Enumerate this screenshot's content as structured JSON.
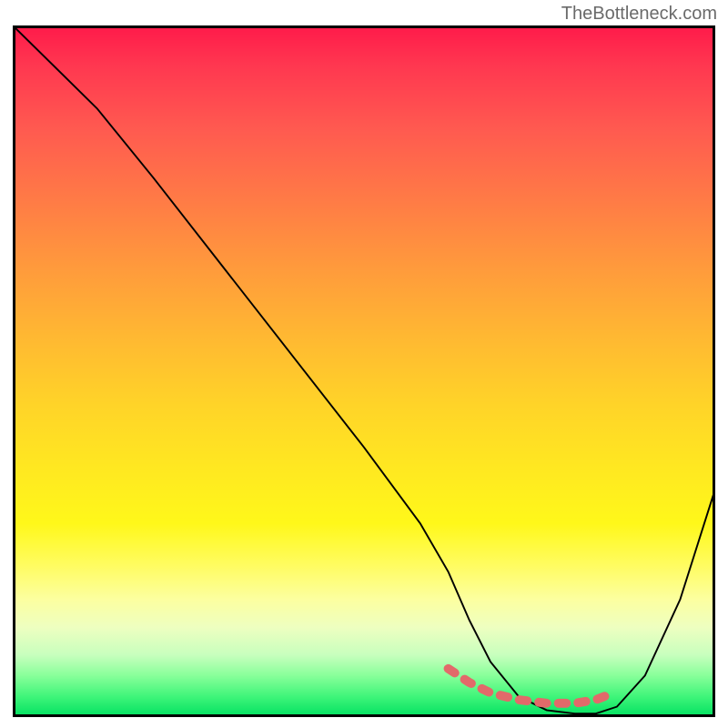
{
  "watermark": "TheBottleneck.com",
  "chart_data": {
    "type": "line",
    "title": "",
    "xlabel": "",
    "ylabel": "",
    "xlim": [
      0,
      100
    ],
    "ylim": [
      0,
      100
    ],
    "series": [
      {
        "name": "bottleneck-curve",
        "x": [
          0,
          3,
          7,
          12,
          20,
          30,
          40,
          50,
          58,
          62,
          65,
          68,
          72,
          76,
          80,
          83,
          86,
          90,
          95,
          100
        ],
        "y": [
          100,
          97,
          93,
          88,
          78,
          65,
          52,
          39,
          28,
          21,
          14,
          8,
          3,
          1,
          0.5,
          0.5,
          1.5,
          6,
          17,
          33
        ]
      }
    ],
    "flat_region": {
      "x": [
        62,
        65,
        68,
        72,
        76,
        80,
        83,
        85.5
      ],
      "y": [
        7,
        5,
        3.5,
        2.5,
        2,
        2,
        2.5,
        3.5
      ]
    },
    "colors": {
      "curve": "#000000",
      "flat_marker": "#e26a6a",
      "gradient_top": "#ff1a4a",
      "gradient_bottom": "#00e060"
    }
  }
}
